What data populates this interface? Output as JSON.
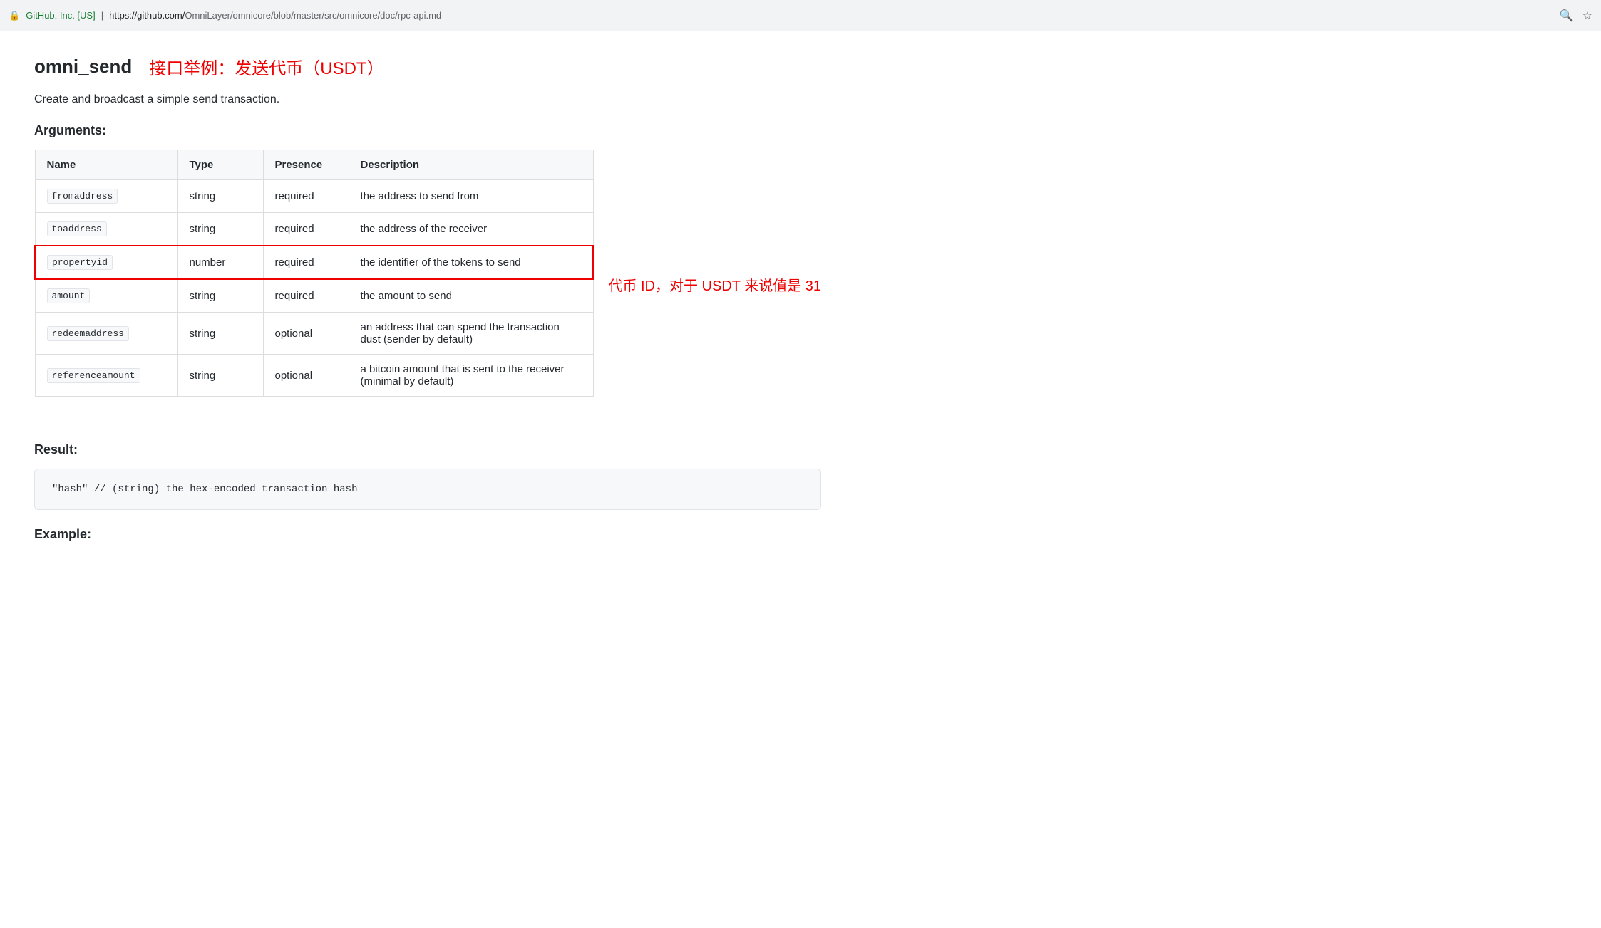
{
  "browser": {
    "lock_icon": "🔒",
    "site_name": "GitHub, Inc. [US]",
    "separator": "|",
    "url_base": "https://github.com/",
    "url_path": "OmniLayer/omnicore/blob/master/src/omnicore/doc/rpc-api.md",
    "search_icon": "🔍",
    "star_icon": "☆"
  },
  "page": {
    "heading_main": "omni_send",
    "heading_annotation": "接口举例：发送代币（USDT）",
    "description": "Create and broadcast a simple send transaction.",
    "arguments_label": "Arguments:",
    "table_headers": {
      "name": "Name",
      "type": "Type",
      "presence": "Presence",
      "description": "Description"
    },
    "table_rows": [
      {
        "name": "fromaddress",
        "type": "string",
        "presence": "required",
        "description": "the address to send from",
        "highlighted": false
      },
      {
        "name": "toaddress",
        "type": "string",
        "presence": "required",
        "description": "the address of the receiver",
        "highlighted": false
      },
      {
        "name": "propertyid",
        "type": "number",
        "presence": "required",
        "description": "the identifier of the tokens to send",
        "highlighted": true,
        "annotation": "代币 ID，对于 USDT 来说值是 31"
      },
      {
        "name": "amount",
        "type": "string",
        "presence": "required",
        "description": "the amount to send",
        "highlighted": false
      },
      {
        "name": "redeemaddress",
        "type": "string",
        "presence": "optional",
        "description": "an address that can spend the transaction dust (sender by default)",
        "highlighted": false
      },
      {
        "name": "referenceamount",
        "type": "string",
        "presence": "optional",
        "description": "a bitcoin amount that is sent to the receiver (minimal by default)",
        "highlighted": false
      }
    ],
    "result_label": "Result:",
    "code_block": "\"hash\"  // (string) the hex-encoded transaction hash",
    "example_label": "Example:"
  }
}
